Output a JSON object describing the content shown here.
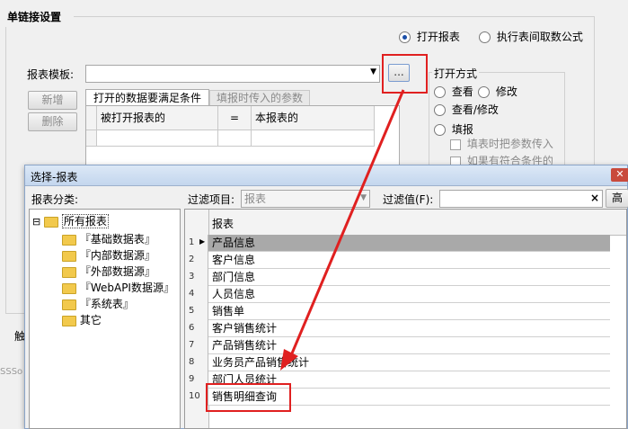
{
  "main": {
    "group_title": "单链接设置",
    "radio_open_report": "打开报表",
    "radio_exec_formula": "执行表间取数公式",
    "template_label": "报表模板:",
    "template_value": "",
    "browse_button": "...",
    "btn_add": "新增",
    "btn_delete": "删除",
    "tab_conditions": "打开的数据要满足条件",
    "tab_params": "填报时传入的参数",
    "grid_col1": "被打开报表的",
    "grid_col2": "=",
    "grid_col3": "本报表的",
    "open_mode_title": "打开方式",
    "mode_view": "查看",
    "mode_edit": "修改",
    "mode_view_edit": "查看/修改",
    "mode_fill": "填报",
    "chk_pass_params": "填表时把参数传入",
    "chk_if_match": "如果有符合条件的",
    "partial_left_char": "触",
    "partial_bottom_text": "SSSo"
  },
  "dialog": {
    "title": "选择-报表",
    "category_label": "报表分类:",
    "filter_item_label": "过滤项目:",
    "filter_item_value": "报表",
    "filter_value_label": "过滤值(F):",
    "filter_value": "",
    "filter_clear": "×",
    "advanced_partial": "高",
    "tree": [
      {
        "label": "所有报表",
        "toggle": "⊟"
      },
      {
        "label": "『基础数据表』"
      },
      {
        "label": "『内部数据源』"
      },
      {
        "label": "『外部数据源』"
      },
      {
        "label": "『WebAPI数据源』"
      },
      {
        "label": "『系统表』"
      },
      {
        "label": "其它"
      }
    ],
    "table_header": "报表",
    "rows": [
      {
        "num": "1",
        "name": "产品信息"
      },
      {
        "num": "2",
        "name": "客户信息"
      },
      {
        "num": "3",
        "name": "部门信息"
      },
      {
        "num": "4",
        "name": "人员信息"
      },
      {
        "num": "5",
        "name": "销售单"
      },
      {
        "num": "6",
        "name": "客户销售统计"
      },
      {
        "num": "7",
        "name": "产品销售统计"
      },
      {
        "num": "8",
        "name": "业务员产品销售统计"
      },
      {
        "num": "9",
        "name": "部门人员统计"
      },
      {
        "num": "10",
        "name": "销售明细查询"
      }
    ]
  },
  "colors": {
    "highlight": "#e02020",
    "selected_row": "#a9a9a9"
  }
}
